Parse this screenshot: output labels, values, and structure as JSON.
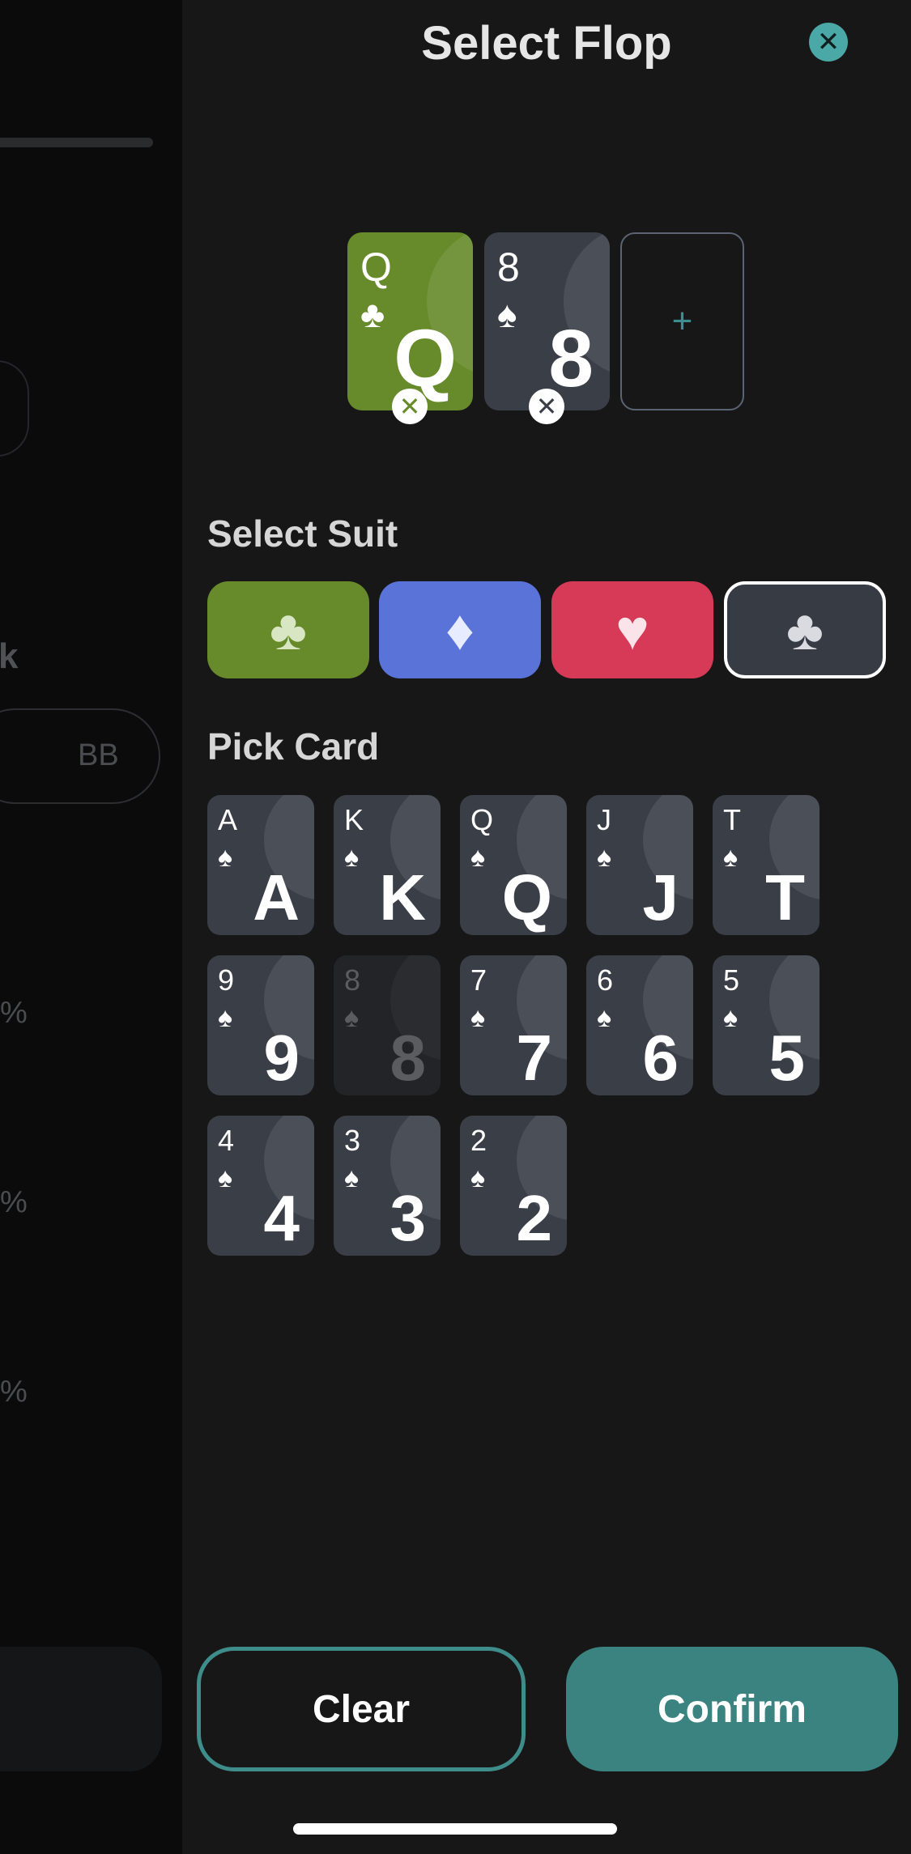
{
  "background": {
    "partial_label": "k",
    "bb_placeholder": "BB",
    "pct_labels": [
      "%",
      "%",
      "%"
    ]
  },
  "modal": {
    "title": "Select Flop",
    "close_icon": "close-icon"
  },
  "flop": {
    "cards": [
      {
        "rank": "Q",
        "suit": "♣",
        "suit_name": "clubs",
        "color": "#678a2a"
      },
      {
        "rank": "8",
        "suit": "♠",
        "suit_name": "spades",
        "color": "#3a3e47"
      }
    ],
    "empty_slot_symbol": "+"
  },
  "select_suit": {
    "label": "Select Suit",
    "options": [
      {
        "name": "clubs",
        "symbol": "♣",
        "color": "#678a2a",
        "selected": false
      },
      {
        "name": "diamonds",
        "symbol": "♦",
        "color": "#5a73d8",
        "selected": false
      },
      {
        "name": "hearts",
        "symbol": "♥",
        "color": "#d63a57",
        "selected": false
      },
      {
        "name": "spades",
        "symbol": "♣",
        "color": "#373b44",
        "selected": true
      }
    ]
  },
  "pick_card": {
    "label": "Pick Card",
    "suit_symbol": "♠",
    "cards": [
      {
        "rank": "A",
        "disabled": false
      },
      {
        "rank": "K",
        "disabled": false
      },
      {
        "rank": "Q",
        "disabled": false
      },
      {
        "rank": "J",
        "disabled": false
      },
      {
        "rank": "T",
        "disabled": false
      },
      {
        "rank": "9",
        "disabled": false
      },
      {
        "rank": "8",
        "disabled": true
      },
      {
        "rank": "7",
        "disabled": false
      },
      {
        "rank": "6",
        "disabled": false
      },
      {
        "rank": "5",
        "disabled": false
      },
      {
        "rank": "4",
        "disabled": false
      },
      {
        "rank": "3",
        "disabled": false
      },
      {
        "rank": "2",
        "disabled": false
      }
    ]
  },
  "actions": {
    "clear_label": "Clear",
    "confirm_label": "Confirm"
  },
  "colors": {
    "accent": "#3b8380",
    "modal_bg": "#171717",
    "card_bg": "#3a3e47"
  }
}
